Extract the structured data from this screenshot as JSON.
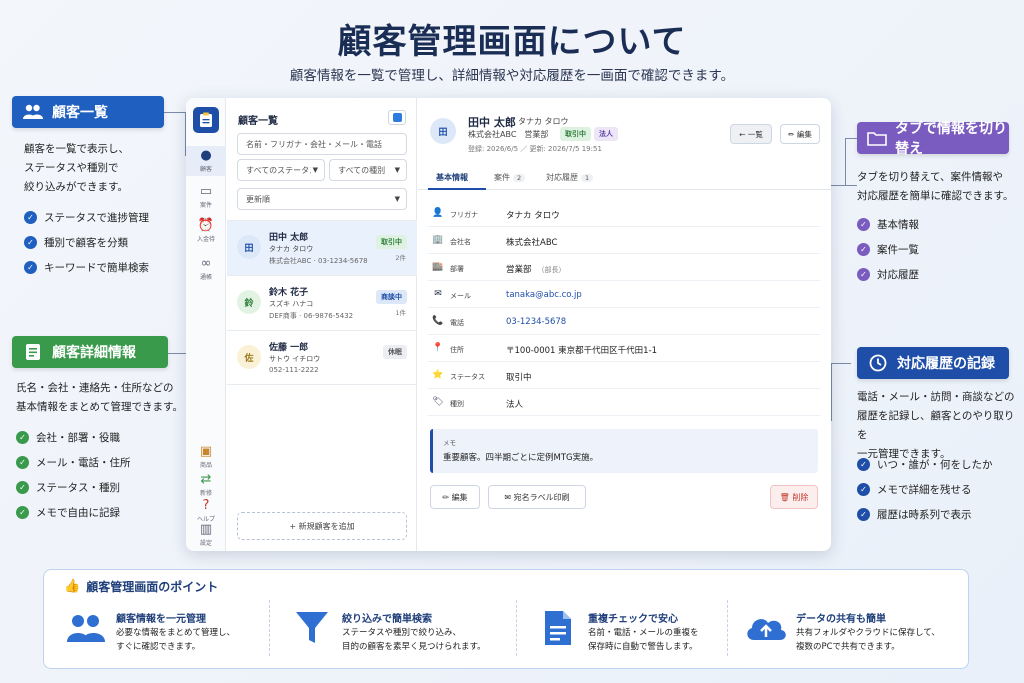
{
  "header": {
    "title": "顧客管理画面について",
    "subtitle": "顧客情報を一覧で管理し、詳細情報や対応履歴を一画面で確認できます。"
  },
  "callouts": {
    "list": {
      "title": "顧客一覧",
      "desc": [
        "顧客を一覧で表示し、",
        "ステータスや種別で",
        "絞り込みができます。"
      ],
      "items": [
        "ステータスで進捗管理",
        "種別で顧客を分類",
        "キーワードで簡単検索"
      ]
    },
    "detail": {
      "title": "顧客詳細情報",
      "desc": [
        "氏名・会社・連絡先・住所などの",
        "基本情報をまとめて管理できます。"
      ],
      "items": [
        "会社・部署・役職",
        "メール・電話・住所",
        "ステータス・種別",
        "メモで自由に記録"
      ]
    },
    "tabs": {
      "title": "タブで情報を切り替え",
      "desc": [
        "タブを切り替えて、案件情報や",
        "対応履歴を簡単に確認できます。"
      ],
      "items": [
        "基本情報",
        "案件一覧",
        "対応履歴"
      ]
    },
    "history": {
      "title": "対応履歴の記録",
      "desc": [
        "電話・メール・訪問・商談などの",
        "履歴を記録し、顧客とのやり取りを",
        "一元管理できます。"
      ],
      "items": [
        "いつ・誰が・何をしたか",
        "メモで詳細を残せる",
        "履歴は時系列で表示"
      ]
    }
  },
  "rail": {
    "items": [
      "顧客",
      "案件",
      "入金待",
      "通帳",
      "商品",
      "新修",
      "ヘルプ",
      "設定"
    ]
  },
  "list_pane": {
    "title": "顧客一覧",
    "search_placeholder": "名前・フリガナ・会社・メール・電話",
    "status_filter": "すべてのステータス",
    "type_filter": "すべての種別",
    "sort": "更新順",
    "customers": [
      {
        "avatar": "田",
        "name": "田中 太郎",
        "kana": "タナカ タロウ",
        "company": "株式会社ABC · 03-1234-5678",
        "badge": "取引中",
        "count": "2件"
      },
      {
        "avatar": "鈴",
        "name": "鈴木 花子",
        "kana": "スズキ ハナコ",
        "company": "DEF商事 · 06-9876-5432",
        "badge": "商談中",
        "count": "1件"
      },
      {
        "avatar": "佐",
        "name": "佐藤 一郎",
        "kana": "サトウ イチロウ",
        "company": "052-111-2222",
        "badge": "休眠",
        "count": ""
      }
    ],
    "add_button": "+ 新規顧客を追加"
  },
  "detail": {
    "avatar": "田",
    "name": "田中 太郎",
    "kana": "タナカ タロウ",
    "company": "株式会社ABC　営業部",
    "tags": [
      "取引中",
      "法人"
    ],
    "dates": "登録: 2026/6/5 ／ 更新: 2026/7/5 19:51",
    "back_button": "← 一覧",
    "edit_button": "✏ 編集",
    "tabs": [
      {
        "label": "基本情報",
        "count": ""
      },
      {
        "label": "案件",
        "count": "2"
      },
      {
        "label": "対応履歴",
        "count": "1"
      }
    ],
    "fields": [
      {
        "icon": "👤",
        "label": "フリガナ",
        "value": "タナカ タロウ",
        "sub": ""
      },
      {
        "icon": "🏢",
        "label": "会社名",
        "value": "株式会社ABC",
        "sub": ""
      },
      {
        "icon": "🏬",
        "label": "部署",
        "value": "営業部",
        "sub": "（部長）"
      },
      {
        "icon": "✉",
        "label": "メール",
        "value": "tanaka@abc.co.jp",
        "sub": ""
      },
      {
        "icon": "📞",
        "label": "電話",
        "value": "03-1234-5678",
        "sub": ""
      },
      {
        "icon": "📍",
        "label": "住所",
        "value": "〒100-0001 東京都千代田区千代田1-1",
        "sub": ""
      },
      {
        "icon": "⭐",
        "label": "ステータス",
        "value": "取引中",
        "sub": ""
      },
      {
        "icon": "🏷",
        "label": "種別",
        "value": "法人",
        "sub": ""
      }
    ],
    "memo_label": "メモ",
    "memo_text": "重要顧客。四半期ごとに定例MTG実施。",
    "footer_edit": "✏ 編集",
    "footer_label": "✉ 宛名ラベル印刷",
    "footer_delete": "🗑 削除"
  },
  "points": {
    "title": "顧客管理画面のポイント",
    "items": [
      {
        "title": "顧客情報を一元管理",
        "desc": [
          "必要な情報をまとめて管理し、",
          "すぐに確認できます。"
        ]
      },
      {
        "title": "絞り込みで簡単検索",
        "desc": [
          "ステータスや種別で絞り込み、",
          "目的の顧客を素早く見つけられます。"
        ]
      },
      {
        "title": "重複チェックで安心",
        "desc": [
          "名前・電話・メールの重複を",
          "保存時に自動で警告します。"
        ]
      },
      {
        "title": "データの共有も簡単",
        "desc": [
          "共有フォルダやクラウドに保存して、",
          "複数のPCで共有できます。"
        ]
      }
    ]
  },
  "colors": {
    "blue": "#1f5fbf",
    "green": "#3a9a4c",
    "purple": "#7a5bbf",
    "navy": "#1f4ea8"
  }
}
